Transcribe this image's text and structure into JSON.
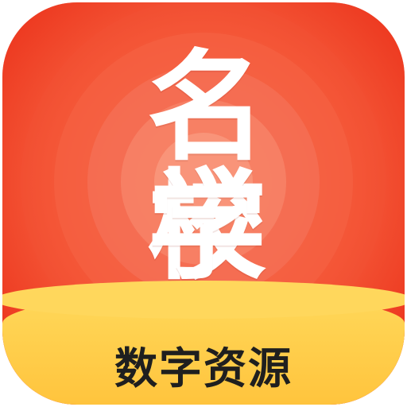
{
  "icon": {
    "title_line_1": "名校",
    "title_line_2": "学习",
    "subtitle": "数字资源"
  },
  "colors": {
    "background": "#f1492f",
    "band": "#ffc43d",
    "title_text": "#ffffff",
    "subtitle_text": "#1f1f1f"
  }
}
